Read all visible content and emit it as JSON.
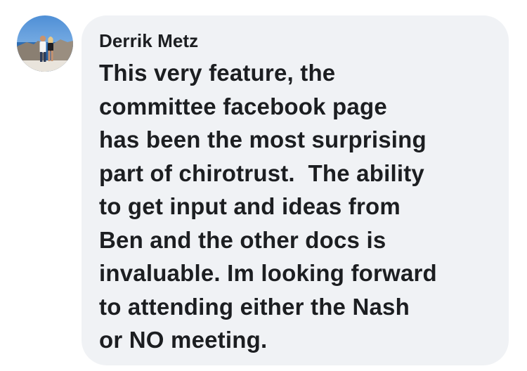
{
  "comment": {
    "author": "Derrik Metz",
    "avatar_icon": "profile-photo",
    "lines": [
      "This very feature, the",
      "committee facebook page",
      "has been the most surprising",
      "part of chirotrust.  The ability",
      "to get input and ideas from",
      "Ben and the other docs is",
      "invaluable. Im looking forward",
      "to attending either the Nash",
      "or NO meeting."
    ],
    "bubble_color": "#f0f2f5",
    "text_color": "#1c1e21"
  }
}
